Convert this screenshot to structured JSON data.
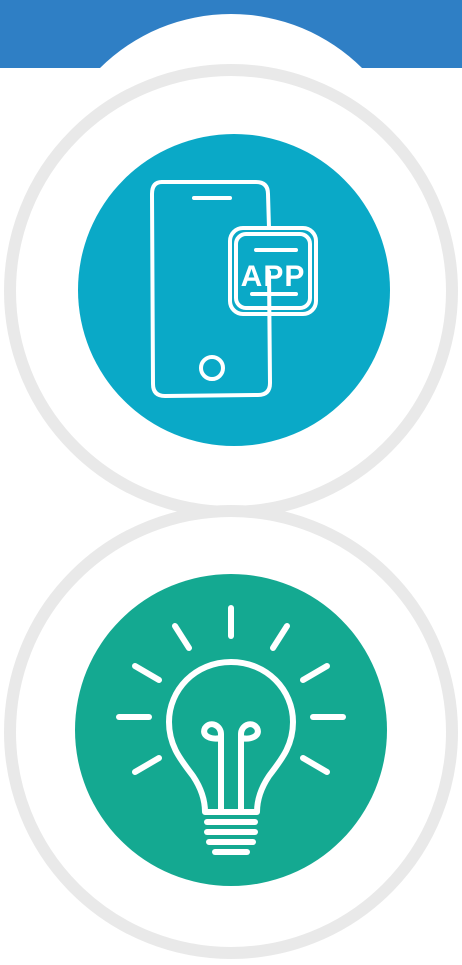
{
  "colors": {
    "header_band": "#2f7fc5",
    "ring": "#e9e9e9",
    "app_disc": "#0aa9c7",
    "idea_disc": "#14a991",
    "icon_stroke": "#ffffff"
  },
  "badges": [
    {
      "icon": "smartphone-app-icon",
      "label": "APP"
    },
    {
      "icon": "lightbulb-icon"
    }
  ]
}
